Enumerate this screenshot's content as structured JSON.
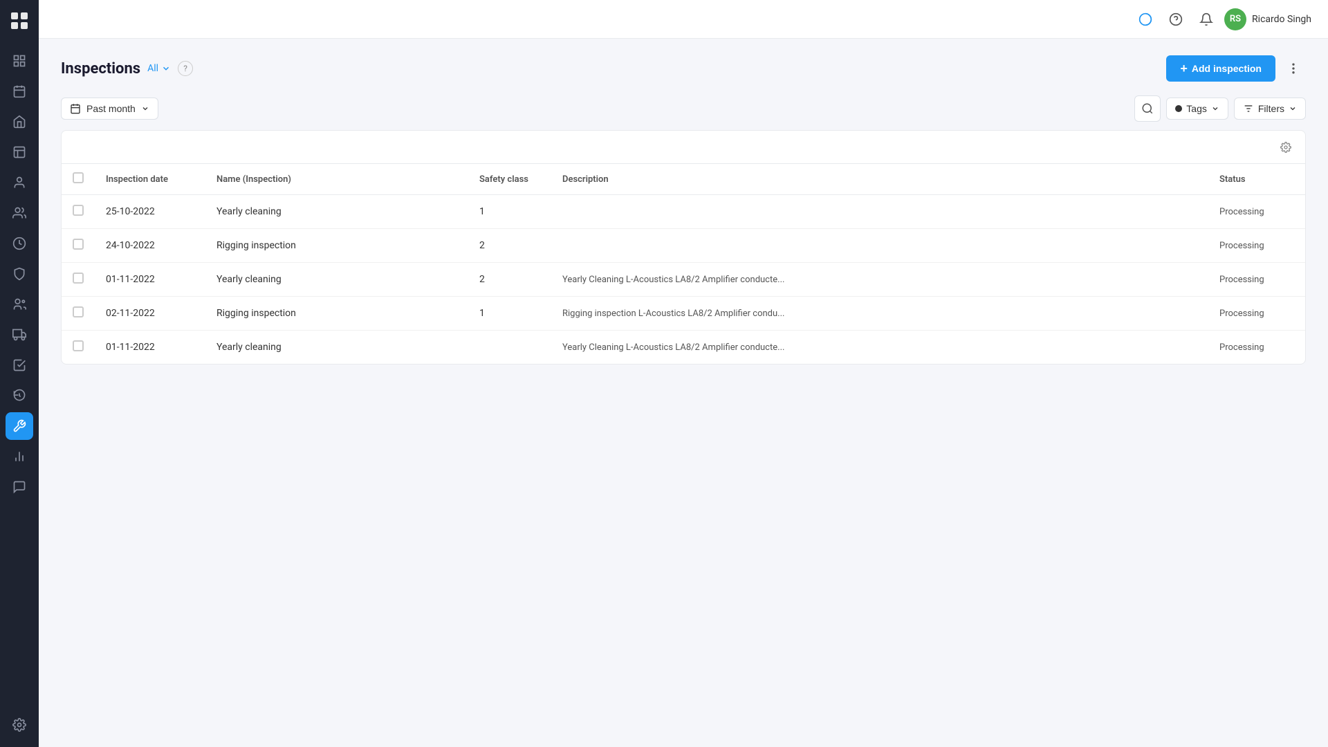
{
  "app": {
    "logo_text": ":::="
  },
  "topbar": {
    "username": "Ricardo Singh",
    "avatar_initials": "RS",
    "avatar_color": "#4caf50"
  },
  "page": {
    "title": "Inspections",
    "filter_label": "All",
    "help_icon": "?",
    "add_button_label": "Add inspection"
  },
  "filters": {
    "date_icon": "📅",
    "date_label": "Past month",
    "dropdown_arrow": "▾",
    "search_icon": "🔍",
    "tags_label": "Tags",
    "tags_icon": "●",
    "filters_label": "Filters",
    "filter_icon": "≡"
  },
  "table": {
    "settings_icon": "⚙",
    "columns": [
      {
        "key": "checkbox",
        "label": ""
      },
      {
        "key": "date",
        "label": "Inspection date"
      },
      {
        "key": "name",
        "label": "Name (Inspection)"
      },
      {
        "key": "safety",
        "label": "Safety class"
      },
      {
        "key": "description",
        "label": "Description"
      },
      {
        "key": "status",
        "label": "Status"
      }
    ],
    "rows": [
      {
        "id": 1,
        "date": "25-10-2022",
        "name": "Yearly cleaning",
        "safety_class": "1",
        "description": "",
        "status": "Processing"
      },
      {
        "id": 2,
        "date": "24-10-2022",
        "name": "Rigging inspection",
        "safety_class": "2",
        "description": "",
        "status": "Processing"
      },
      {
        "id": 3,
        "date": "01-11-2022",
        "name": "Yearly cleaning",
        "safety_class": "2",
        "description": "Yearly Cleaning L-Acoustics LA8/2 Amplifier conducte...",
        "status": "Processing"
      },
      {
        "id": 4,
        "date": "02-11-2022",
        "name": "Rigging inspection",
        "safety_class": "1",
        "description": "Rigging inspection L-Acoustics LA8/2 Amplifier condu...",
        "status": "Processing"
      },
      {
        "id": 5,
        "date": "01-11-2022",
        "name": "Yearly cleaning",
        "safety_class": "",
        "description": "Yearly Cleaning L-Acoustics LA8/2 Amplifier conducte...",
        "status": "Processing"
      }
    ]
  },
  "sidebar": {
    "items": [
      {
        "icon": "⊞",
        "name": "dashboard",
        "active": false
      },
      {
        "icon": "📅",
        "name": "calendar",
        "active": false
      },
      {
        "icon": "🏠",
        "name": "home",
        "active": false
      },
      {
        "icon": "📊",
        "name": "reports",
        "active": false
      },
      {
        "icon": "👤",
        "name": "user",
        "active": false
      },
      {
        "icon": "👥",
        "name": "contacts",
        "active": false
      },
      {
        "icon": "💰",
        "name": "finance",
        "active": false
      },
      {
        "icon": "🛡",
        "name": "safety",
        "active": false
      },
      {
        "icon": "👫",
        "name": "team",
        "active": false
      },
      {
        "icon": "🚚",
        "name": "logistics",
        "active": false
      },
      {
        "icon": "✅",
        "name": "tasks",
        "active": false
      },
      {
        "icon": "🕐",
        "name": "history",
        "active": false
      },
      {
        "icon": "🔧",
        "name": "inspections",
        "active": true
      },
      {
        "icon": "📈",
        "name": "analytics",
        "active": false
      },
      {
        "icon": "💬",
        "name": "messages",
        "active": false
      },
      {
        "icon": "⚙",
        "name": "settings",
        "active": false
      }
    ]
  }
}
